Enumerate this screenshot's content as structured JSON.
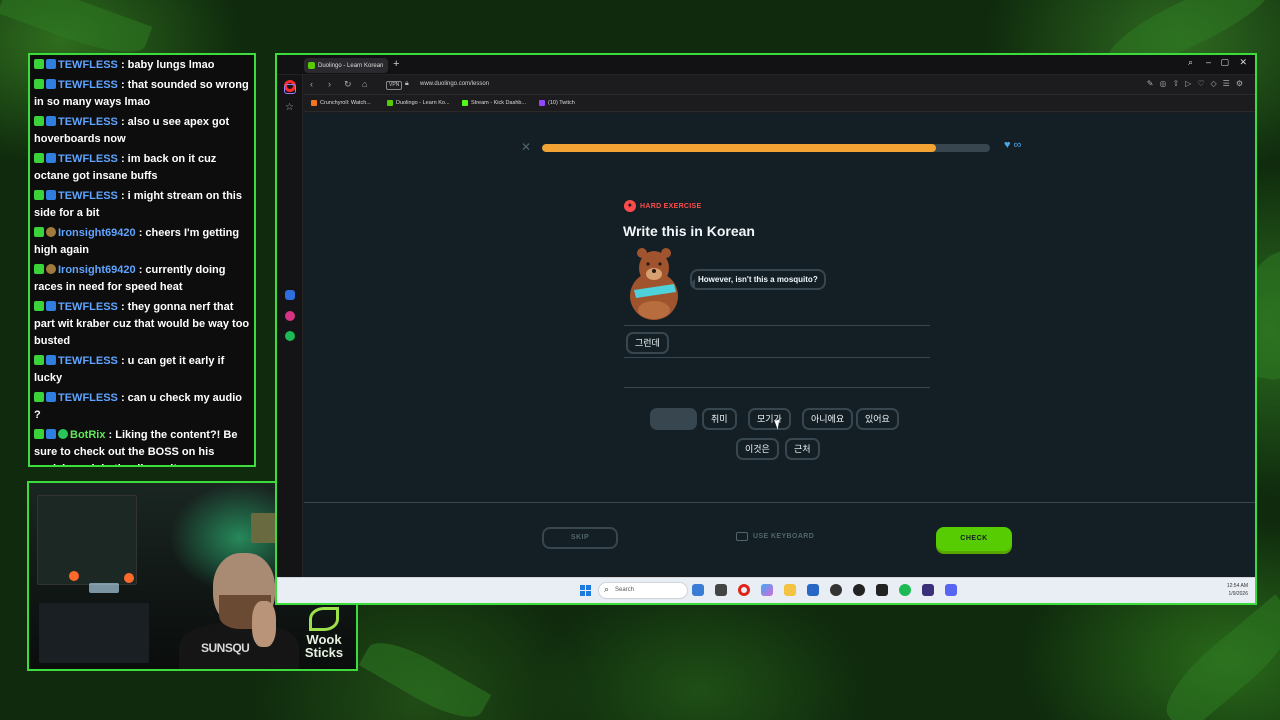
{
  "chat": {
    "messages": [
      {
        "user": "TEWFLESS",
        "text": ": baby lungs lmao",
        "kind": "user"
      },
      {
        "user": "TEWFLESS",
        "text": ": that sounded so wrong in so many ways lmao",
        "kind": "user"
      },
      {
        "user": "TEWFLESS",
        "text": ": also u see apex got hoverboards now",
        "kind": "user"
      },
      {
        "user": "TEWFLESS",
        "text": ": im back on it cuz octane got insane buffs",
        "kind": "user"
      },
      {
        "user": "TEWFLESS",
        "text": ": i might stream on this side for a bit",
        "kind": "user"
      },
      {
        "user": "Ironsight69420",
        "text": ": cheers I'm getting high again",
        "kind": "pill"
      },
      {
        "user": "Ironsight69420",
        "text": ": currently doing races in need for speed heat",
        "kind": "pill"
      },
      {
        "user": "TEWFLESS",
        "text": ": they gonna nerf that part wit kraber cuz that would be way too busted",
        "kind": "user"
      },
      {
        "user": "TEWFLESS",
        "text": ": u can get it early if lucky",
        "kind": "user"
      },
      {
        "user": "TEWFLESS",
        "text": ": can u check my audio ?",
        "kind": "user"
      },
      {
        "user": "BotRix",
        "text": ": Liking the content?! Be sure to check out the BOSS on his socials, or join the discord! https://linktr.ee/thecanniboss",
        "kind": "bot"
      }
    ]
  },
  "webcam": {
    "shirt_text": "SUNSQU",
    "logo_text": "Wook Sticks"
  },
  "browser": {
    "tab_title": "Duolingo - Learn Korean",
    "new_tab": "+",
    "vpn_label": "VPN",
    "url": "www.duolingo.com/lesson",
    "bookmarks": [
      {
        "label": "Crunchyroll: Watch...",
        "color": "#f47521"
      },
      {
        "label": "Duolingo - Learn Ko...",
        "color": "#58cc02"
      },
      {
        "label": "Stream - Kick Dashb...",
        "color": "#53fc18"
      },
      {
        "label": "(10) Twitch",
        "color": "#9146ff"
      }
    ]
  },
  "lesson": {
    "progress_fraction": 0.88,
    "hearts": "∞",
    "exercise_tag": "HARD EXERCISE",
    "prompt": "Write this in Korean",
    "speech": "However, isn't this a mosquito?",
    "answer_tiles": [
      "그런데"
    ],
    "word_bank_row1": [
      "",
      "취미",
      "모기가",
      "아니에요",
      "있어요"
    ],
    "word_bank_row2": [
      "이것은",
      "근처"
    ],
    "skip_label": "SKIP",
    "keyboard_label": "USE KEYBOARD",
    "check_label": "CHECK"
  },
  "taskbar": {
    "search_placeholder": "Search",
    "time": "12:54 AM",
    "date": "1/9/2026"
  },
  "colors": {
    "accent_green": "#58cc02",
    "progress": "#f3a234",
    "danger": "#ff4b4b",
    "stream_border": "#3cdc3c"
  }
}
